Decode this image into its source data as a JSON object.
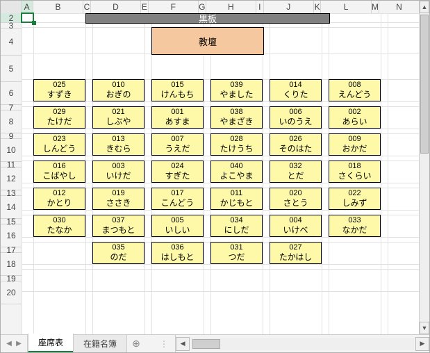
{
  "columns": [
    {
      "label": "A",
      "w": 17,
      "sel": true
    },
    {
      "label": "B",
      "w": 75,
      "sel": false
    },
    {
      "label": "C",
      "w": 10,
      "sel": false
    },
    {
      "label": "D",
      "w": 75,
      "sel": false
    },
    {
      "label": "E",
      "w": 10,
      "sel": false
    },
    {
      "label": "F",
      "w": 75,
      "sel": false
    },
    {
      "label": "G",
      "w": 10,
      "sel": false
    },
    {
      "label": "H",
      "w": 75,
      "sel": false
    },
    {
      "label": "I",
      "w": 10,
      "sel": false
    },
    {
      "label": "J",
      "w": 75,
      "sel": false
    },
    {
      "label": "K",
      "w": 10,
      "sel": false
    },
    {
      "label": "L",
      "w": 75,
      "sel": false
    },
    {
      "label": "M",
      "w": 10,
      "sel": false
    },
    {
      "label": "N",
      "w": 60,
      "sel": false
    }
  ],
  "rows": [
    {
      "label": "2",
      "h": 13,
      "sel": true
    },
    {
      "label": "3",
      "h": 7,
      "sel": false
    },
    {
      "label": "4",
      "h": 38,
      "sel": false
    },
    {
      "label": "5",
      "h": 37,
      "sel": false
    },
    {
      "label": "6",
      "h": 32,
      "sel": false
    },
    {
      "label": "7",
      "h": 7,
      "sel": false
    },
    {
      "label": "8",
      "h": 32,
      "sel": false
    },
    {
      "label": "9",
      "h": 7,
      "sel": false
    },
    {
      "label": "10",
      "h": 32,
      "sel": false
    },
    {
      "label": "11",
      "h": 7,
      "sel": false
    },
    {
      "label": "12",
      "h": 32,
      "sel": false
    },
    {
      "label": "13",
      "h": 7,
      "sel": false
    },
    {
      "label": "14",
      "h": 32,
      "sel": false
    },
    {
      "label": "15",
      "h": 7,
      "sel": false
    },
    {
      "label": "16",
      "h": 32,
      "sel": false
    },
    {
      "label": "17",
      "h": 7,
      "sel": false
    },
    {
      "label": "18",
      "h": 32,
      "sel": false
    },
    {
      "label": "19",
      "h": 7,
      "sel": false
    },
    {
      "label": "20",
      "h": 32,
      "sel": false
    }
  ],
  "blackboard_label": "黒板",
  "lectern_label": "教壇",
  "seats": [
    [
      {
        "id": "025",
        "name": "すずき"
      },
      {
        "id": "010",
        "name": "おぎの"
      },
      {
        "id": "015",
        "name": "けんもち"
      },
      {
        "id": "039",
        "name": "やました"
      },
      {
        "id": "014",
        "name": "くりた"
      },
      {
        "id": "008",
        "name": "えんどう"
      }
    ],
    [
      {
        "id": "029",
        "name": "たけだ"
      },
      {
        "id": "021",
        "name": "しぶや"
      },
      {
        "id": "001",
        "name": "あすま"
      },
      {
        "id": "038",
        "name": "やまざき"
      },
      {
        "id": "006",
        "name": "いのうえ"
      },
      {
        "id": "002",
        "name": "あらい"
      }
    ],
    [
      {
        "id": "023",
        "name": "しんどう"
      },
      {
        "id": "013",
        "name": "きむら"
      },
      {
        "id": "007",
        "name": "うえだ"
      },
      {
        "id": "028",
        "name": "たけうち"
      },
      {
        "id": "026",
        "name": "そのはた"
      },
      {
        "id": "009",
        "name": "おかだ"
      }
    ],
    [
      {
        "id": "016",
        "name": "こばやし"
      },
      {
        "id": "003",
        "name": "いけだ"
      },
      {
        "id": "024",
        "name": "すぎた"
      },
      {
        "id": "040",
        "name": "よこやま"
      },
      {
        "id": "032",
        "name": "とだ"
      },
      {
        "id": "018",
        "name": "さくらい"
      }
    ],
    [
      {
        "id": "012",
        "name": "かとり"
      },
      {
        "id": "019",
        "name": "ささき"
      },
      {
        "id": "017",
        "name": "こんどう"
      },
      {
        "id": "011",
        "name": "かじもと"
      },
      {
        "id": "020",
        "name": "さとう"
      },
      {
        "id": "022",
        "name": "しみず"
      }
    ],
    [
      {
        "id": "030",
        "name": "たなか"
      },
      {
        "id": "037",
        "name": "まつもと"
      },
      {
        "id": "005",
        "name": "いしい"
      },
      {
        "id": "034",
        "name": "にしだ"
      },
      {
        "id": "004",
        "name": "いけべ"
      },
      {
        "id": "033",
        "name": "なかだ"
      }
    ],
    [
      null,
      {
        "id": "035",
        "name": "のだ"
      },
      {
        "id": "036",
        "name": "はしもと"
      },
      {
        "id": "031",
        "name": "つだ"
      },
      {
        "id": "027",
        "name": "たかはし"
      },
      null
    ]
  ],
  "tabs": [
    {
      "label": "座席表",
      "active": true
    },
    {
      "label": "在籍名簿",
      "active": false
    }
  ]
}
